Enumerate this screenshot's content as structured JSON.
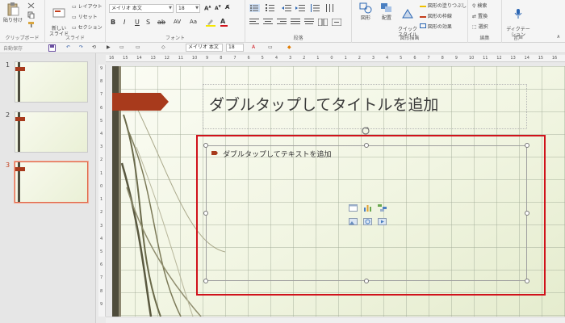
{
  "ribbon": {
    "clipboard": {
      "paste_label": "貼り付け",
      "group_label": "クリップボード"
    },
    "slides": {
      "new_slide_label": "新しい\nスライド",
      "layout_label": "レイアウト",
      "reset_label": "リセット",
      "section_label": "セクション",
      "group_label": "スライド"
    },
    "font": {
      "font_name": "メイリオ 本文",
      "font_size": "18",
      "group_label": "フォント"
    },
    "paragraph": {
      "group_label": "段落"
    },
    "drawing": {
      "shape_label": "図形",
      "arrange_label": "配置",
      "quick_style_label": "クイック\nスタイル",
      "fill_label": "図形の塗りつぶし",
      "outline_label": "図形の枠線",
      "effect_label": "図形の効果",
      "group_label": "図形描画"
    },
    "editing": {
      "find_label": "検索",
      "replace_label": "置換",
      "select_label": "選択",
      "group_label": "編集"
    },
    "voice": {
      "dictate_label": "ディクテー\nション",
      "group_label": "音声"
    }
  },
  "minibar": {
    "autosave_label": "自動保存",
    "font_name": "メイリオ 本文",
    "font_size": "18"
  },
  "slides_panel": {
    "items": [
      {
        "number": "1"
      },
      {
        "number": "2"
      },
      {
        "number": "3"
      }
    ]
  },
  "ruler": {
    "h_ticks": [
      "16",
      "15",
      "14",
      "13",
      "12",
      "11",
      "10",
      "9",
      "8",
      "7",
      "6",
      "5",
      "4",
      "3",
      "2",
      "1",
      "0",
      "1",
      "2",
      "3",
      "4",
      "5",
      "6",
      "7",
      "8",
      "9",
      "10",
      "11",
      "12",
      "13",
      "14",
      "15",
      "16"
    ],
    "v_ticks": [
      "9",
      "8",
      "7",
      "6",
      "5",
      "4",
      "3",
      "2",
      "1",
      "0",
      "1",
      "2",
      "3",
      "4",
      "5",
      "6",
      "7",
      "8",
      "9"
    ]
  },
  "slide": {
    "title_placeholder": "ダブルタップしてタイトルを追加",
    "text_placeholder": "ダブルタップしてテキストを追加"
  },
  "colors": {
    "accent": "#a83a1c",
    "highlight": "#d0121b",
    "selected_thumb": "#e0684b",
    "stripe": "#4e4c3b"
  }
}
